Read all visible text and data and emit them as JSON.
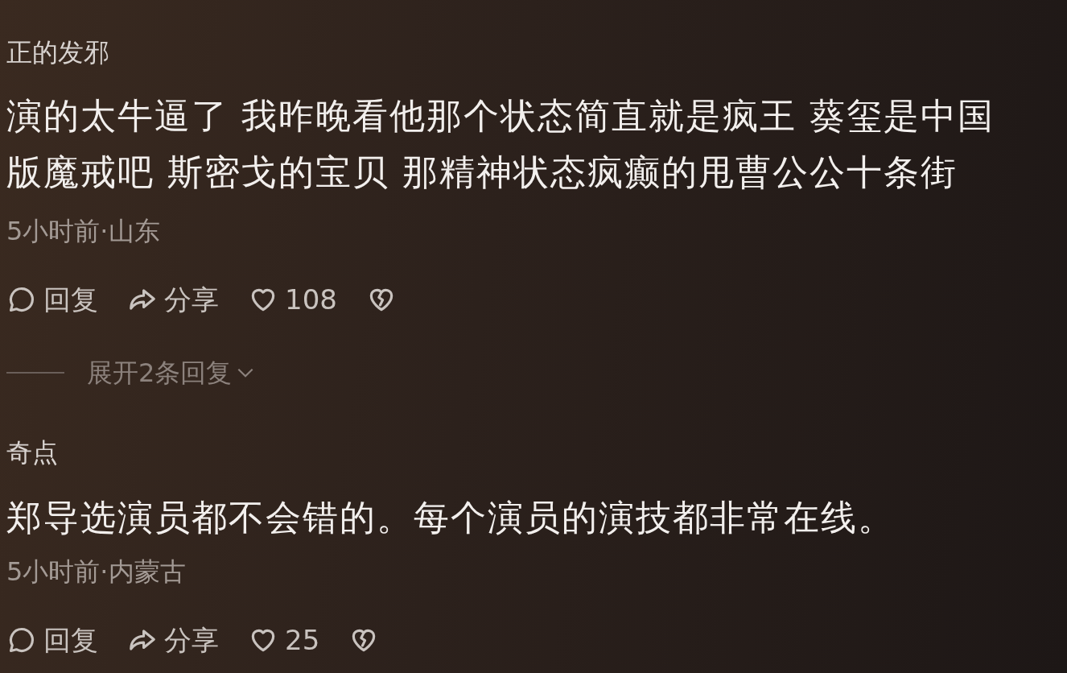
{
  "comments": [
    {
      "author": "正的发邪",
      "text": "演的太牛逼了 我昨晚看他那个状态简直就是疯王 葵玺是中国版魔戒吧 斯密戈的宝贝 那精神状态疯癫的甩曹公公十条街",
      "meta": "5小时前·山东",
      "reply": "回复",
      "share": "分享",
      "likes": "108",
      "replies_toggle": "展开2条回复"
    },
    {
      "author": "奇点",
      "text": "郑导选演员都不会错的。每个演员的演技都非常在线。",
      "meta": "5小时前·内蒙古",
      "reply": "回复",
      "share": "分享",
      "likes": "25"
    }
  ]
}
